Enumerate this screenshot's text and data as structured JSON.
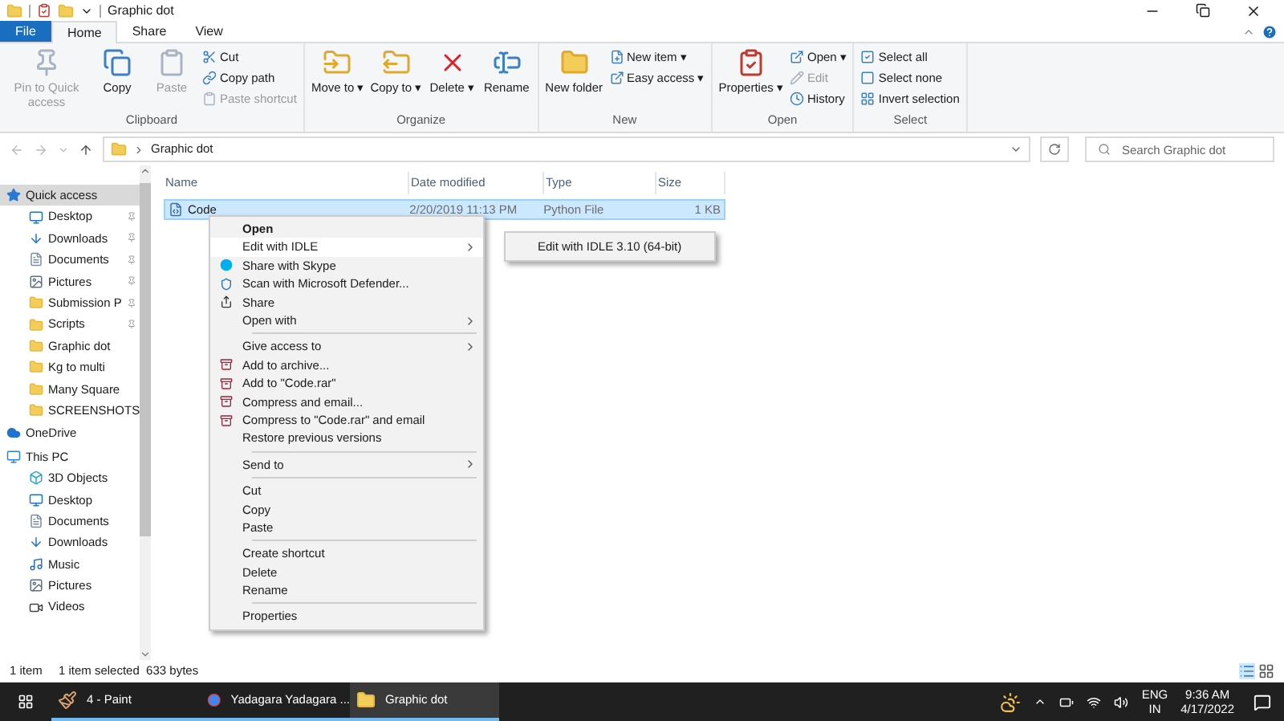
{
  "window": {
    "title": "Graphic dot"
  },
  "ribbon_tabs": [
    {
      "label": "File",
      "selected": false,
      "kind": "file"
    },
    {
      "label": "Home",
      "selected": true,
      "kind": "tab"
    },
    {
      "label": "Share",
      "selected": false,
      "kind": "tab"
    },
    {
      "label": "View",
      "selected": false,
      "kind": "tab"
    }
  ],
  "ribbon_groups": [
    {
      "label": "Clipboard",
      "large": [
        {
          "label": "Pin to Quick access",
          "disabled": true
        },
        {
          "label": "Copy",
          "disabled": false
        },
        {
          "label": "Paste",
          "disabled": true
        }
      ],
      "small": [
        {
          "label": "Cut",
          "disabled": false
        },
        {
          "label": "Copy path",
          "disabled": false
        },
        {
          "label": "Paste shortcut",
          "disabled": true
        }
      ]
    },
    {
      "label": "Organize",
      "large": [
        {
          "label": "Move to ▾",
          "disabled": false
        },
        {
          "label": "Copy to ▾",
          "disabled": false
        },
        {
          "label": "Delete ▾",
          "disabled": false
        },
        {
          "label": "Rename",
          "disabled": false
        }
      ]
    },
    {
      "label": "New",
      "large": [
        {
          "label": "New folder",
          "disabled": false
        }
      ],
      "small": [
        {
          "label": "New item ▾",
          "disabled": false
        },
        {
          "label": "Easy access ▾",
          "disabled": false
        }
      ]
    },
    {
      "label": "Open",
      "large": [
        {
          "label": "Properties ▾",
          "disabled": false
        }
      ],
      "small": [
        {
          "label": "Open ▾",
          "disabled": false
        },
        {
          "label": "Edit",
          "disabled": true
        },
        {
          "label": "History",
          "disabled": false
        }
      ]
    },
    {
      "label": "Select",
      "small": [
        {
          "label": "Select all",
          "disabled": false
        },
        {
          "label": "Select none",
          "disabled": false
        },
        {
          "label": "Invert selection",
          "disabled": false
        }
      ]
    }
  ],
  "address_bar": {
    "path": "Graphic dot"
  },
  "search": {
    "placeholder": "Search Graphic dot"
  },
  "nav_pane": [
    {
      "label": "Quick access",
      "selected": true,
      "pinned": false
    },
    {
      "label": "Desktop",
      "selected": false,
      "pinned": true
    },
    {
      "label": "Downloads",
      "selected": false,
      "pinned": true
    },
    {
      "label": "Documents",
      "selected": false,
      "pinned": true
    },
    {
      "label": "Pictures",
      "selected": false,
      "pinned": true
    },
    {
      "label": "Submission P",
      "selected": false,
      "pinned": true
    },
    {
      "label": "Scripts",
      "selected": false,
      "pinned": true
    },
    {
      "label": "Graphic dot",
      "selected": false,
      "pinned": false
    },
    {
      "label": "Kg to multi",
      "selected": false,
      "pinned": false
    },
    {
      "label": "Many Square",
      "selected": false,
      "pinned": false
    },
    {
      "label": "SCREENSHOTS",
      "selected": false,
      "pinned": false
    },
    {
      "label": "OneDrive",
      "selected": false,
      "pinned": false
    },
    {
      "label": "This PC",
      "selected": false,
      "pinned": false
    },
    {
      "label": "3D Objects",
      "selected": false,
      "pinned": false
    },
    {
      "label": "Desktop",
      "selected": false,
      "pinned": false
    },
    {
      "label": "Documents",
      "selected": false,
      "pinned": false
    },
    {
      "label": "Downloads",
      "selected": false,
      "pinned": false
    },
    {
      "label": "Music",
      "selected": false,
      "pinned": false
    },
    {
      "label": "Pictures",
      "selected": false,
      "pinned": false
    },
    {
      "label": "Videos",
      "selected": false,
      "pinned": false
    }
  ],
  "file_list": {
    "columns": [
      "Name",
      "Date modified",
      "Type",
      "Size"
    ],
    "rows": [
      {
        "name": "Code",
        "date": "2/20/2019 11:13 PM",
        "type": "Python File",
        "size": "1 KB",
        "selected": true
      }
    ]
  },
  "context_menu": [
    {
      "label": "Open",
      "bold": true,
      "submenu": false,
      "highlighted": false,
      "separator_before": false
    },
    {
      "label": "Edit with IDLE",
      "bold": false,
      "submenu": true,
      "highlighted": true,
      "separator_before": false
    },
    {
      "label": "Share with Skype",
      "bold": false,
      "submenu": false,
      "highlighted": false,
      "separator_before": false
    },
    {
      "label": "Scan with Microsoft Defender...",
      "bold": false,
      "submenu": false,
      "highlighted": false,
      "separator_before": false
    },
    {
      "label": "Share",
      "bold": false,
      "submenu": false,
      "highlighted": false,
      "separator_before": false
    },
    {
      "label": "Open with",
      "bold": false,
      "submenu": true,
      "highlighted": false,
      "separator_before": false
    },
    {
      "label": "Give access to",
      "bold": false,
      "submenu": true,
      "highlighted": false,
      "separator_before": true
    },
    {
      "label": "Add to archive...",
      "bold": false,
      "submenu": false,
      "highlighted": false,
      "separator_before": false
    },
    {
      "label": "Add to \"Code.rar\"",
      "bold": false,
      "submenu": false,
      "highlighted": false,
      "separator_before": false
    },
    {
      "label": "Compress and email...",
      "bold": false,
      "submenu": false,
      "highlighted": false,
      "separator_before": false
    },
    {
      "label": "Compress to \"Code.rar\" and email",
      "bold": false,
      "submenu": false,
      "highlighted": false,
      "separator_before": false
    },
    {
      "label": "Restore previous versions",
      "bold": false,
      "submenu": false,
      "highlighted": false,
      "separator_before": false
    },
    {
      "label": "Send to",
      "bold": false,
      "submenu": true,
      "highlighted": false,
      "separator_before": true
    },
    {
      "label": "Cut",
      "bold": false,
      "submenu": false,
      "highlighted": false,
      "separator_before": true
    },
    {
      "label": "Copy",
      "bold": false,
      "submenu": false,
      "highlighted": false,
      "separator_before": false
    },
    {
      "label": "Paste",
      "bold": false,
      "submenu": false,
      "highlighted": false,
      "separator_before": false
    },
    {
      "label": "Create shortcut",
      "bold": false,
      "submenu": false,
      "highlighted": false,
      "separator_before": true
    },
    {
      "label": "Delete",
      "bold": false,
      "submenu": false,
      "highlighted": false,
      "separator_before": false
    },
    {
      "label": "Rename",
      "bold": false,
      "submenu": false,
      "highlighted": false,
      "separator_before": false
    },
    {
      "label": "Properties",
      "bold": false,
      "submenu": false,
      "highlighted": false,
      "separator_before": true
    }
  ],
  "submenu": [
    {
      "label": "Edit with IDLE 3.10 (64-bit)"
    }
  ],
  "status_bar": {
    "count": "1 item",
    "selection": "1 item selected  633 bytes"
  },
  "taskbar": {
    "apps": [
      {
        "label": "4 - Paint",
        "selected": false
      },
      {
        "label": "Yadagara Yadagara ...",
        "selected": false
      },
      {
        "label": "Graphic dot",
        "selected": true
      }
    ],
    "language": [
      "ENG",
      "IN"
    ],
    "time": "9:36 AM",
    "date": "4/17/2022"
  }
}
